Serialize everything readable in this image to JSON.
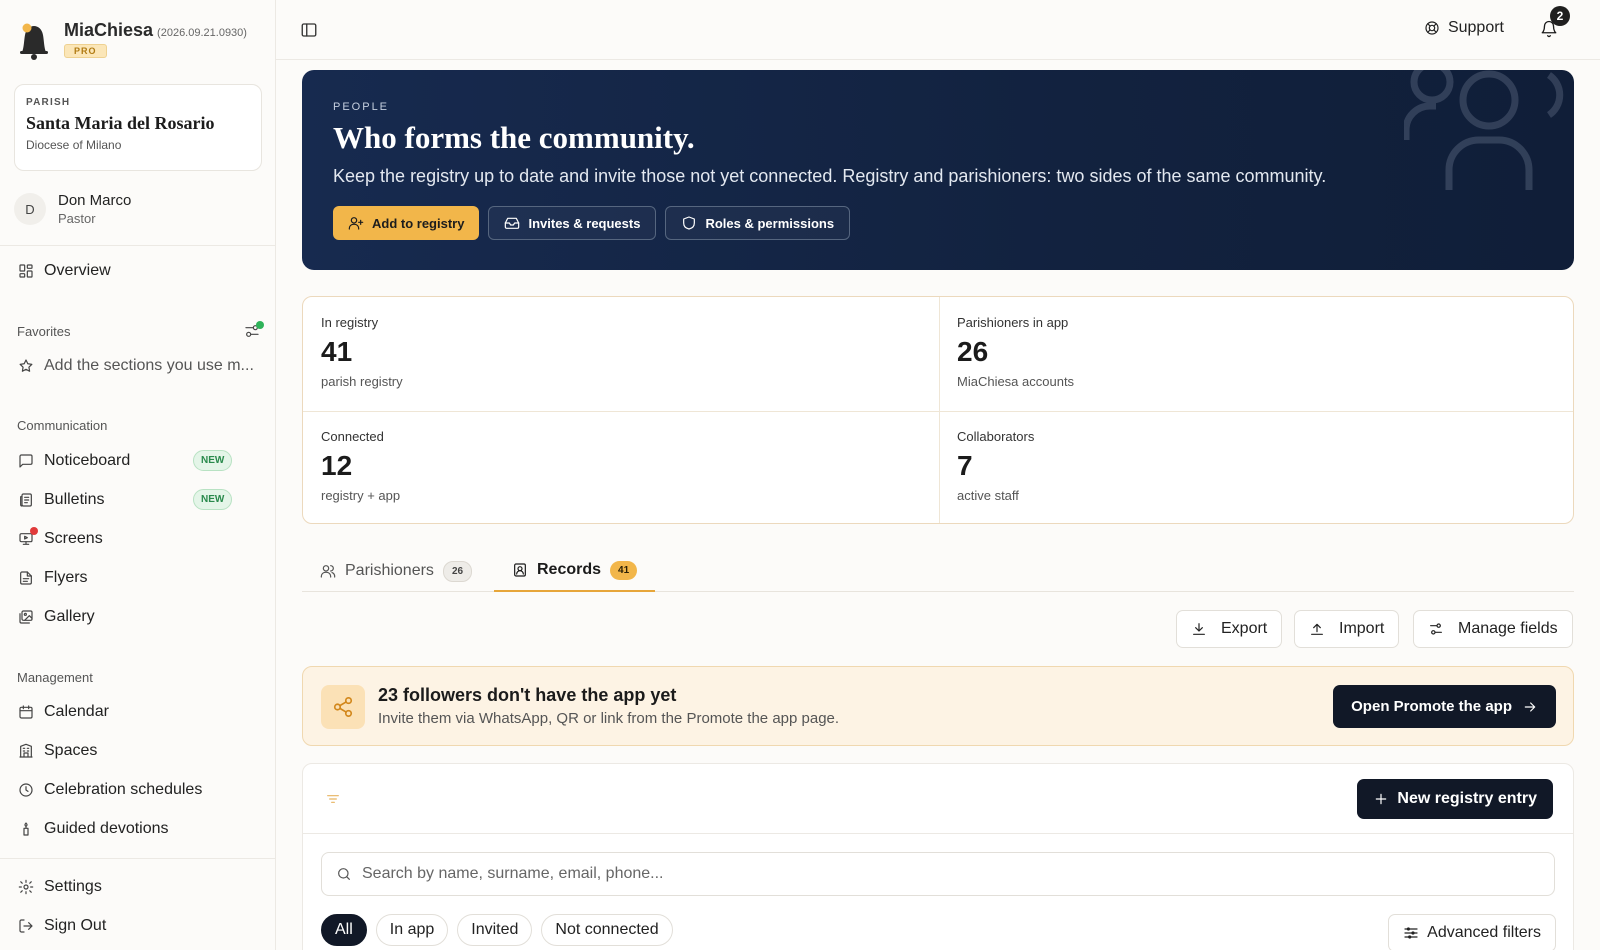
{
  "app": {
    "name": "MiaChiesa",
    "version": "(2026.09.21.0930)",
    "plan_badge": "PRO"
  },
  "parish": {
    "label": "PARISH",
    "name": "Santa Maria del Rosario",
    "diocese": "Diocese of Milano"
  },
  "user": {
    "initial": "D",
    "name": "Don Marco",
    "role": "Pastor"
  },
  "sidebar": {
    "overview": "Overview",
    "favorites_title": "Favorites",
    "favorites_hint": "Add the sections you use m...",
    "communication_title": "Communication",
    "communication": [
      {
        "label": "Noticeboard",
        "badge": "NEW"
      },
      {
        "label": "Bulletins",
        "badge": "NEW"
      },
      {
        "label": "Screens"
      },
      {
        "label": "Flyers"
      },
      {
        "label": "Gallery"
      }
    ],
    "management_title": "Management",
    "management": [
      {
        "label": "Calendar"
      },
      {
        "label": "Spaces"
      },
      {
        "label": "Celebration schedules"
      },
      {
        "label": "Guided devotions"
      }
    ],
    "settings": "Settings",
    "sign_out": "Sign Out"
  },
  "topbar": {
    "support": "Support",
    "notifications_count": "2"
  },
  "hero": {
    "eyebrow": "PEOPLE",
    "title": "Who forms the community.",
    "subtitle": "Keep the registry up to date and invite those not yet connected. Registry and parishioners: two sides of the same community.",
    "buttons": [
      "Add to registry",
      "Invites & requests",
      "Roles & permissions"
    ]
  },
  "stats": [
    {
      "label": "In registry",
      "value": "41",
      "desc": "parish registry"
    },
    {
      "label": "Parishioners in app",
      "value": "26",
      "desc": "MiaChiesa accounts"
    },
    {
      "label": "Connected",
      "value": "12",
      "desc": "registry + app"
    },
    {
      "label": "Collaborators",
      "value": "7",
      "desc": "active staff"
    }
  ],
  "tabs": [
    {
      "label": "Parishioners",
      "count": "26"
    },
    {
      "label": "Records",
      "count": "41"
    }
  ],
  "toolbar": {
    "export": "Export",
    "import": "Import",
    "manage_fields": "Manage fields"
  },
  "promo": {
    "title": "23 followers don't have the app yet",
    "subtitle": "Invite them via WhatsApp, QR or link from the Promote the app page.",
    "button": "Open Promote the app"
  },
  "registry": {
    "new_entry": "New registry entry",
    "search_placeholder": "Search by name, surname, email, phone...",
    "chips": [
      "All",
      "In app",
      "Invited",
      "Not connected"
    ],
    "advanced_filters": "Advanced filters"
  },
  "colors": {
    "accent": "#f2b64a",
    "navy": "#12223f",
    "dark_button": "#111827",
    "new_badge": "#2a8a4c"
  }
}
